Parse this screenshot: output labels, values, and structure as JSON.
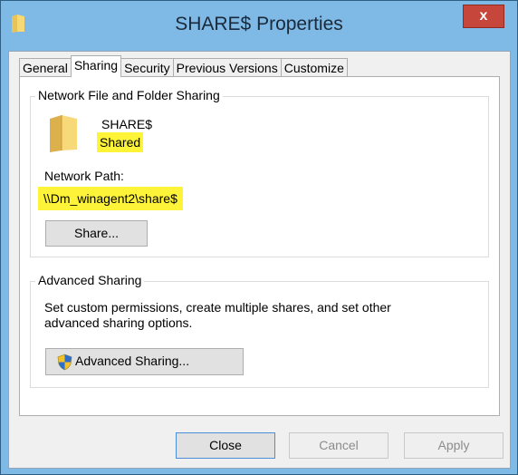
{
  "window": {
    "title": "SHARE$ Properties",
    "close_glyph": "x"
  },
  "tabs": [
    "General",
    "Sharing",
    "Security",
    "Previous Versions",
    "Customize"
  ],
  "active_tab": "Sharing",
  "network_sharing": {
    "group_label": "Network File and Folder Sharing",
    "folder_icon": "folder-icon",
    "share_name": "SHARE$",
    "share_status": "Shared",
    "network_path_label": "Network Path:",
    "network_path": "\\\\Dm_winagent2\\share$",
    "share_button": "Share..."
  },
  "advanced_sharing": {
    "group_label": "Advanced Sharing",
    "description_line1": "Set custom permissions, create multiple shares, and set other",
    "description_line2": "advanced sharing options.",
    "button_icon": "uac-shield-icon",
    "button_label": "Advanced Sharing..."
  },
  "footer": {
    "close": "Close",
    "cancel": "Cancel",
    "apply": "Apply"
  },
  "colors": {
    "titlebar": "#7fb9e6",
    "highlight": "#fdf43a",
    "close_button": "#c7463c"
  }
}
